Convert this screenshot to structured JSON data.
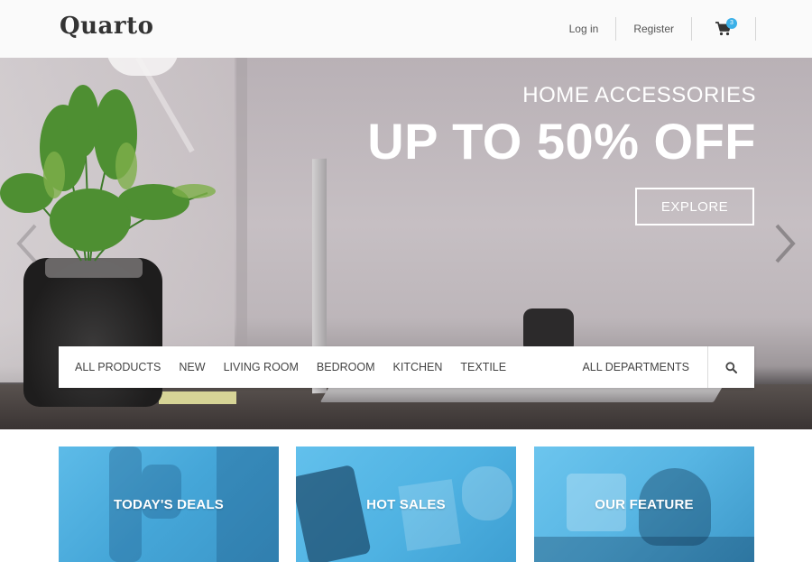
{
  "header": {
    "logo": "Quarto",
    "login": "Log in",
    "register": "Register",
    "cart_count": "3",
    "cart_icon": "shopping-cart-icon"
  },
  "hero": {
    "subtitle": "HOME ACCESSORIES",
    "title": "UP TO 50% OFF",
    "button_label": "EXPLORE",
    "prev_icon": "chevron-left-icon",
    "next_icon": "chevron-right-icon"
  },
  "categories": {
    "items": [
      "ALL PRODUCTS",
      "NEW",
      "LIVING ROOM",
      "BEDROOM",
      "KITCHEN",
      "TEXTILE"
    ],
    "departments_label": "ALL DEPARTMENTS",
    "search_icon": "search-icon"
  },
  "promos": [
    {
      "label": "TODAY'S DEALS"
    },
    {
      "label": "HOT SALES"
    },
    {
      "label": "OUR FEATURE"
    }
  ],
  "colors": {
    "accent": "#3bb0e8",
    "tile_blue": "#4fb2e2",
    "text_dark": "#333333"
  }
}
